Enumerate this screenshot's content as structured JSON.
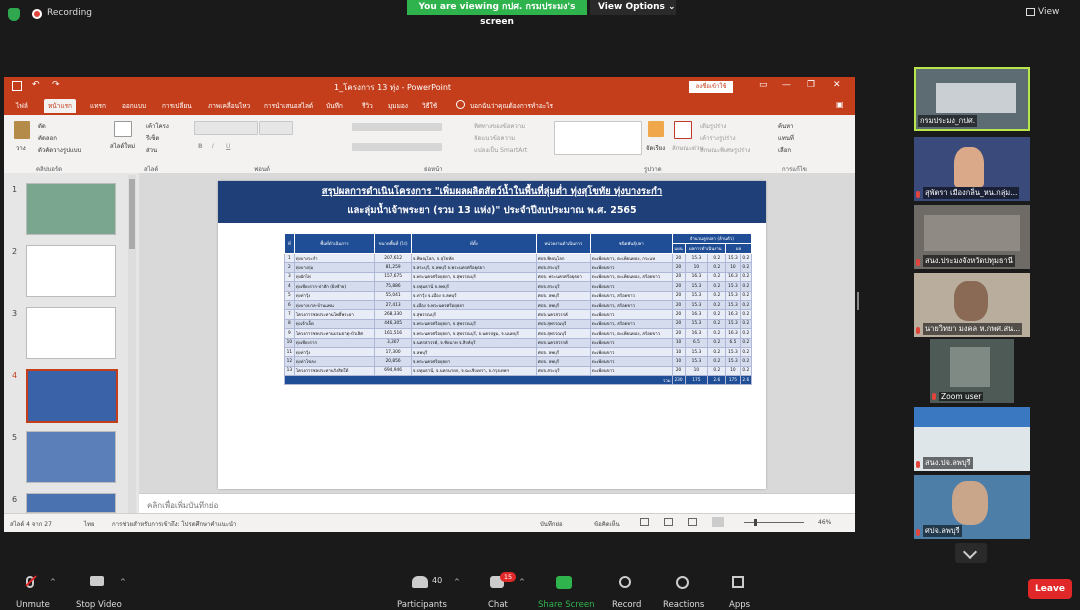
{
  "topbar": {
    "recording": "Recording",
    "viewing": "You are viewing กปศ. กรมประมง's screen",
    "view_options": "View Options",
    "view": "View"
  },
  "ppt": {
    "title": "1_โครงการ 13 ทุ่ง  -  PowerPoint",
    "signin": "ลงชื่อเข้าใช้",
    "tabs": [
      "ไฟล์",
      "หน้าแรก",
      "แทรก",
      "ออกแบบ",
      "การเปลี่ยน",
      "ภาพเคลื่อนไหว",
      "การนำเสนอสไลด์",
      "บันทึก",
      "รีวิว",
      "มุมมอง",
      "วิธีใช้",
      "บอกฉันว่าคุณต้องการทำอะไร"
    ],
    "ribbon": {
      "paste": "วาง",
      "cut": "ตัด",
      "copy": "คัดลอก",
      "format_painter": "ตัวคัดวางรูปแบบ",
      "new_slide": "สไลด์ใหม่",
      "layout": "เค้าโครง",
      "reset": "รีเซ็ต",
      "section": "ส่วน",
      "group_clipboard": "คลิปบอร์ด",
      "group_slides": "สไลด์",
      "group_font": "ฟอนต์",
      "group_paragraph": "ย่อหน้า",
      "group_drawing": "รูปวาด",
      "group_editing": "การแก้ไข",
      "text_direction": "ทิศทางของข้อความ",
      "align_text": "จัดแนวข้อความ",
      "smartart": "แปลงเป็น SmartArt",
      "arrange": "จัดเรียง",
      "quick_styles": "ลักษณะด่วน",
      "shape_fill": "เติมรูปร่าง",
      "shape_outline": "เค้าร่างรูปร่าง",
      "shape_effects": "ลักษณะพิเศษรูปร่าง",
      "find": "ค้นหา",
      "replace": "แทนที่",
      "select": "เลือก"
    },
    "thumbs": [
      "1",
      "2",
      "3",
      "4",
      "5",
      "6"
    ],
    "notes": "คลิกเพื่อเพิ่มบันทึกย่อ",
    "status": {
      "slide": "สไลด์ 4 จาก 27",
      "lang": "ไทย",
      "access": "การช่วยสำหรับการเข้าถึง: โปรดศึกษาคำแนะนำ",
      "notes": "บันทึกย่อ",
      "comments": "ข้อคิดเห็น",
      "zoom": "46%"
    }
  },
  "slide": {
    "title1": "สรุปผลการดำเนินโครงการ \"เพิ่มผลผลิตสัตว์น้ำในพื้นที่ลุ่มต่ำ ทุ่งสุโขทัย ทุ่งบางระกำ",
    "title2": "และลุ่มน้ำเจ้าพระยา (รวม 13 แห่ง)\" ประจำปีงบประมาณ พ.ศ. 2565",
    "headers": [
      "ที่",
      "พื้นที่ดำเนินการ",
      "ขนาดพื้นที่ (ไร่)",
      "ที่ตั้ง",
      "หน่วยงานดำเนินการ",
      "ชนิดพันธุ์ปลา",
      "จำนวนลูกปลา (ล้านตัว)"
    ],
    "subheaders": [
      "แผน",
      "ผลการดำเนินงาน",
      "ผล"
    ],
    "rows": [
      [
        "1",
        "ทุ่งบางระกำ",
        "207,612",
        "จ.พิษณุโลก, จ.สุโขทัย",
        "ศปจ.พิษณุโลก",
        "ตะเพียนขาว, ตะเพียนทอง, กระแห",
        "20",
        "15.3",
        "0.2",
        "15.3",
        "0.2"
      ],
      [
        "2",
        "ทุ่งบางกุ่ม",
        "81,259",
        "จ.สระบุรี, จ.ลพบุรี จ.พระนครศรีอยุธยา",
        "ศปจ.สระบุรี",
        "ตะเพียนขาว",
        "20",
        "10",
        "0.2",
        "10",
        "0.2"
      ],
      [
        "3",
        "ทุ่งผักไห่",
        "157,675",
        "จ.พระนครศรีอยุธยา, จ.สุพรรณบุรี",
        "ศปจ. พระนครศรีอยุธยา",
        "ตะเพียนขาว, ตะเพียนทอง, สร้อยขาว",
        "20",
        "16.3",
        "0.2",
        "16.3",
        "0.2"
      ],
      [
        "4",
        "ทุ่งเชียงราก-ป่าสัก (ฝั่งซ้าย)",
        "75,886",
        "จ.ปทุมธานี จ.ลพบุรี",
        "ศปจ.สระบุรี",
        "ตะเพียนขาว",
        "20",
        "15.3",
        "0.2",
        "15.3",
        "0.2"
      ],
      [
        "5",
        "ทุ่งท่าวุ้ง",
        "55,041",
        "จ.ท่าวุ้ง จ.เมือง จ.ลพบุรี",
        "ศปจ. ลพบุรี",
        "ตะเพียนขาว, สร้อยขาว",
        "20",
        "15.3",
        "0.2",
        "15.3",
        "0.2"
      ],
      [
        "6",
        "ทุ่งบางบาล-บ้านแพน",
        "27,413",
        "จ.เมือง จ.พระนครศรีอยุธยา",
        "ศปจ. ลพบุรี",
        "ตะเพียนขาว, สร้อยขาว",
        "20",
        "15.3",
        "0.2",
        "15.3",
        "0.2"
      ],
      [
        "7",
        "โครงการชลประทานโพธิ์พระยา",
        "268,330",
        "จ.สุพรรณบุรี",
        "ศปจ.นครสวรรค์",
        "ตะเพียนขาว",
        "20",
        "16.3",
        "0.2",
        "16.3",
        "0.2"
      ],
      [
        "8",
        "ทุ่งเจ้าเจ็ด",
        "446,305",
        "จ.พระนครศรีอยุธยา, จ.สุพรรณบุรี",
        "ศปจ.สุพรรณบุรี",
        "ตะเพียนขาว, สร้อยขาว",
        "20",
        "15.3",
        "0.2",
        "15.3",
        "0.2"
      ],
      [
        "9",
        "โครงการชลประทานบรมธาตุ-บัวเลิศ",
        "161,516",
        "จ.พระนครศรีอยุธยา, จ.สุพรรณบุรี, จ.นครปฐม, จ.นนทบุรี",
        "ศปจ.สุพรรณบุรี",
        "ตะเพียนขาว, ตะเพียนทอง, สร้อยขาว",
        "20",
        "16.3",
        "0.2",
        "16.3",
        "0.2"
      ],
      [
        "10",
        "ทุ่งเชียงราก",
        "3,307",
        "จ.นครสวรรค์, จ.ชัยนาท จ.สิงห์บุรี",
        "ศปจ.นครสวรรค์",
        "ตะเพียนขาว",
        "10",
        "6.5",
        "0.2",
        "6.5",
        "0.2"
      ],
      [
        "11",
        "ทุ่งท่าวุ้ง",
        "17,300",
        "จ.ลพบุรี",
        "ศปจ. ลพบุรี",
        "ตะเพียนขาว",
        "10",
        "15.3",
        "0.2",
        "15.3",
        "0.2"
      ],
      [
        "12",
        "ทุ่งท่าโขลง",
        "20,856",
        "จ.พระนครศรีอยุธยา",
        "ศปจ. ลพบุรี",
        "ตะเพียนขาว",
        "10",
        "15.3",
        "0.2",
        "15.3",
        "0.2"
      ],
      [
        "13",
        "โครงการชลประทานรังสิตใต้",
        "694,946",
        "จ.ปทุมธานี, จ.นครนายก, จ.ฉะเชิงเทรา, จ.กรุงเทพฯ",
        "ศปจ.สระบุรี",
        "ตะเพียนขาว",
        "20",
        "10",
        "0.2",
        "10",
        "0.2"
      ]
    ],
    "total": [
      "รวม",
      "230",
      "175",
      "2.6",
      "175",
      "2.6"
    ]
  },
  "gallery": [
    {
      "name": "กรมประมง_กปศ."
    },
    {
      "name": "สุพัตรา เมืองกลิ่น_หน.กลุ่ม..."
    },
    {
      "name": "สนง.ประมงจังหวัดปทุมธานี"
    },
    {
      "name": "นายวิทยา มงคล ห.กพศ.สน..."
    },
    {
      "name": "Zoom user"
    },
    {
      "name": "สนง.ปจ.ลพบุรี"
    },
    {
      "name": "ศปจ.ลพบุรี"
    }
  ],
  "toolbar": {
    "unmute": "Unmute",
    "stop_video": "Stop Video",
    "participants": "Participants",
    "participants_count": "40",
    "chat": "Chat",
    "chat_badge": "15",
    "share": "Share Screen",
    "record": "Record",
    "reactions": "Reactions",
    "apps": "Apps",
    "leave": "Leave"
  },
  "colors": {
    "ppt_accent": "#c43e1c",
    "zoom_green": "#2fb34d",
    "leave_red": "#e02828",
    "slide_header": "#1f3f78"
  }
}
